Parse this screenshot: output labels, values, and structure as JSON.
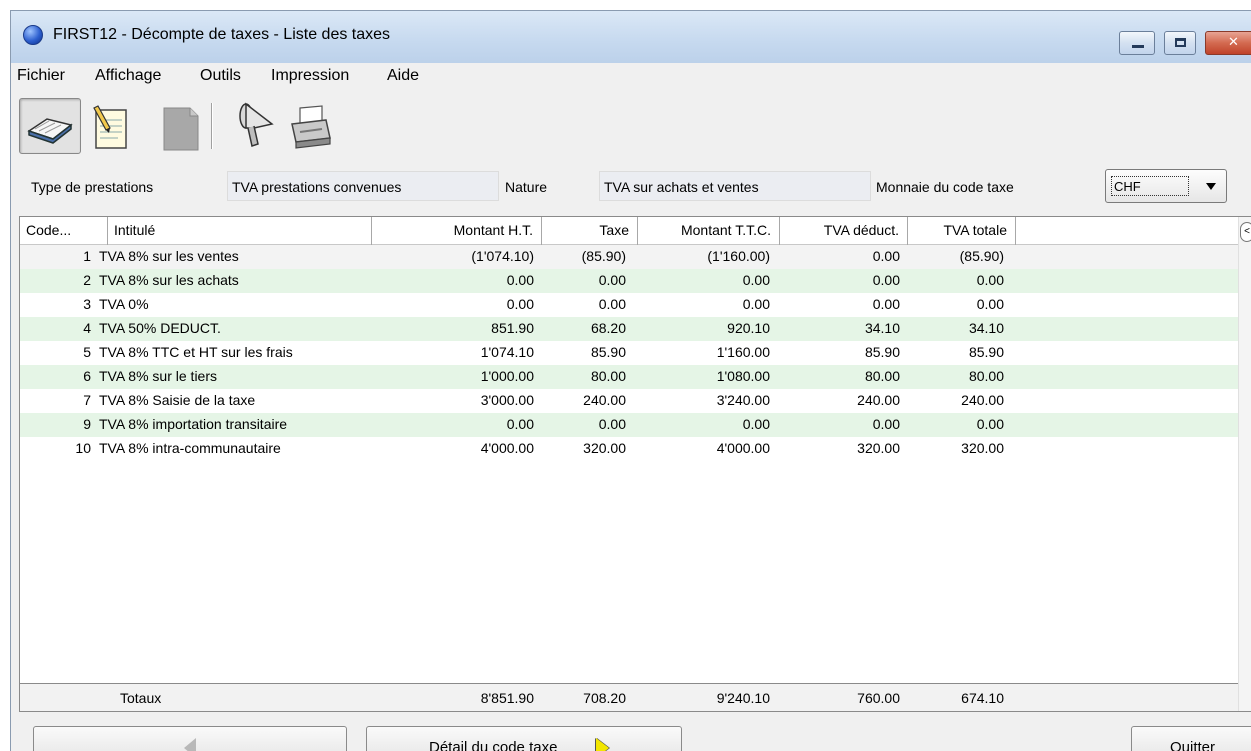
{
  "window": {
    "title": "FIRST12 - Décompte de taxes - Liste des taxes"
  },
  "menu": [
    "Fichier",
    "Affichage",
    "Outils",
    "Impression",
    "Aide"
  ],
  "toolbar": {
    "icons": [
      "book-icon",
      "notepad-pencil-icon",
      "document-gray-icon",
      "funnel-icon",
      "printer-icon"
    ]
  },
  "filters": {
    "type_label": "Type de prestations",
    "type_value": "TVA prestations convenues",
    "nature_label": "Nature",
    "nature_value": "TVA sur achats et ventes",
    "currency_label": "Monnaie du code taxe",
    "currency_value": "CHF"
  },
  "table": {
    "columns": [
      "Code...",
      "Intitulé",
      "Montant H.T.",
      "Taxe",
      "Montant T.T.C.",
      "TVA déduct.",
      "TVA totale"
    ],
    "rows": [
      {
        "code": "1",
        "label": "TVA 8% sur les ventes",
        "ht": "(1'074.10)",
        "taxe": "(85.90)",
        "ttc": "(1'160.00)",
        "deduct": "0.00",
        "totale": "(85.90)"
      },
      {
        "code": "2",
        "label": "TVA 8% sur les achats",
        "ht": "0.00",
        "taxe": "0.00",
        "ttc": "0.00",
        "deduct": "0.00",
        "totale": "0.00"
      },
      {
        "code": "3",
        "label": "TVA 0%",
        "ht": "0.00",
        "taxe": "0.00",
        "ttc": "0.00",
        "deduct": "0.00",
        "totale": "0.00"
      },
      {
        "code": "4",
        "label": "TVA 50% DEDUCT.",
        "ht": "851.90",
        "taxe": "68.20",
        "ttc": "920.10",
        "deduct": "34.10",
        "totale": "34.10"
      },
      {
        "code": "5",
        "label": "TVA 8% TTC et HT sur les frais",
        "ht": "1'074.10",
        "taxe": "85.90",
        "ttc": "1'160.00",
        "deduct": "85.90",
        "totale": "85.90"
      },
      {
        "code": "6",
        "label": "TVA 8% sur le tiers",
        "ht": "1'000.00",
        "taxe": "80.00",
        "ttc": "1'080.00",
        "deduct": "80.00",
        "totale": "80.00"
      },
      {
        "code": "7",
        "label": "TVA 8% Saisie de la taxe",
        "ht": "3'000.00",
        "taxe": "240.00",
        "ttc": "3'240.00",
        "deduct": "240.00",
        "totale": "240.00"
      },
      {
        "code": "9",
        "label": "TVA 8% importation transitaire",
        "ht": "0.00",
        "taxe": "0.00",
        "ttc": "0.00",
        "deduct": "0.00",
        "totale": "0.00"
      },
      {
        "code": "10",
        "label": "TVA 8% intra-communautaire",
        "ht": "4'000.00",
        "taxe": "320.00",
        "ttc": "4'000.00",
        "deduct": "320.00",
        "totale": "320.00"
      }
    ],
    "totals": {
      "label": "Totaux",
      "ht": "8'851.90",
      "taxe": "708.20",
      "ttc": "9'240.10",
      "deduct": "760.00",
      "totale": "674.10"
    }
  },
  "buttons": {
    "detail": "Détail du code taxe",
    "quit": "Quitter"
  },
  "colors": {
    "row_alt": "#e5f5e6",
    "titlebar": "#c6d9ef"
  }
}
